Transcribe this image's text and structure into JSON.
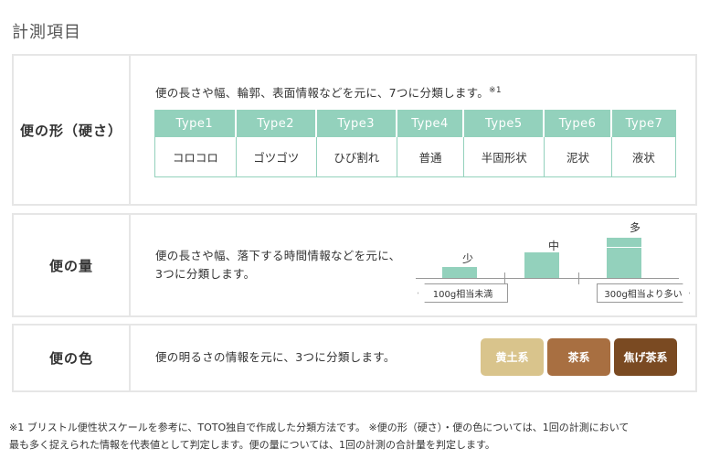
{
  "title": "計測項目",
  "shape": {
    "label": "便の形（硬さ）",
    "desc": "便の長さや幅、輪郭、表面情報などを元に、7つに分類します。",
    "note_mark": "※1",
    "headers": [
      "Type1",
      "Type2",
      "Type3",
      "Type4",
      "Type5",
      "Type6",
      "Type7"
    ],
    "values": [
      "コロコロ",
      "ゴツゴツ",
      "ひび割れ",
      "普通",
      "半固形状",
      "泥状",
      "液状"
    ]
  },
  "amount": {
    "label": "便の量",
    "desc_line1": "便の長さや幅、落下する時間情報などを元に、",
    "desc_line2": "3つに分類します。",
    "levels": [
      "少",
      "中",
      "多"
    ],
    "min_tag": "100g相当未満",
    "max_tag": "300g相当より多い"
  },
  "color": {
    "label": "便の色",
    "desc": "便の明るさの情報を元に、3つに分類します。",
    "swatches": [
      {
        "label": "黄土系",
        "color": "#d9c48c"
      },
      {
        "label": "茶系",
        "color": "#a86f41"
      },
      {
        "label": "焦げ茶系",
        "color": "#7a4a22"
      }
    ]
  },
  "footnote_line1": "※1 ブリストル便性状スケールを参考に、TOTO独自で作成した分類方法です。 ※便の形（硬さ）・便の色については、1回の計測において",
  "footnote_line2": "最も多く捉えられた情報を代表値として判定します。便の量については、1回の計測の合計量を判定します。"
}
